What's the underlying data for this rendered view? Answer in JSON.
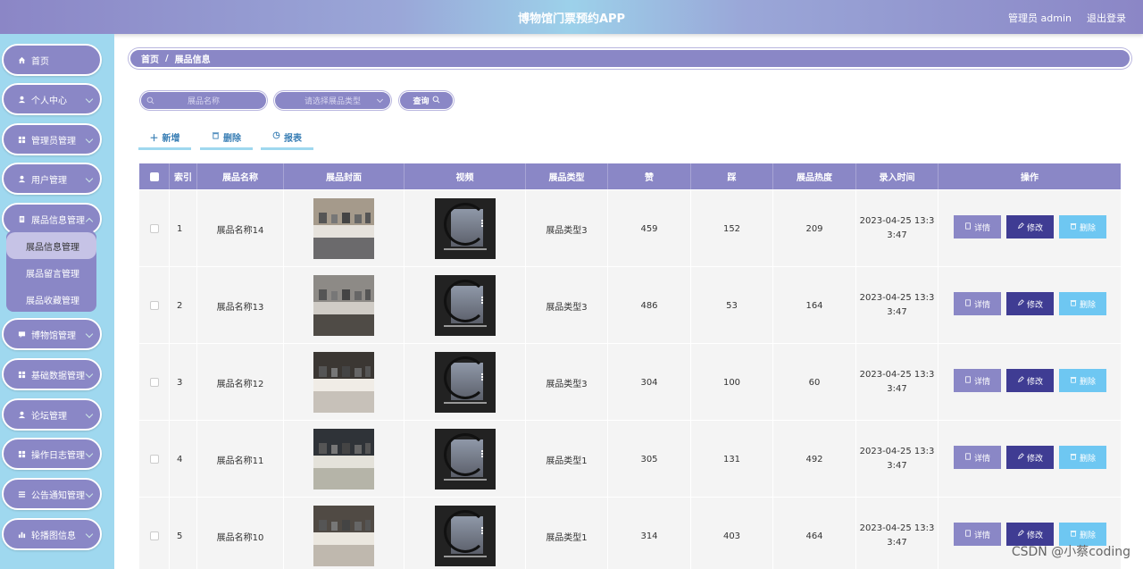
{
  "header": {
    "title": "博物馆门票预约APP",
    "admin": "管理员 admin",
    "logout": "退出登录"
  },
  "sidebar": {
    "items": [
      {
        "label": "首页",
        "icon": "home-icon"
      },
      {
        "label": "个人中心",
        "icon": "user-icon"
      },
      {
        "label": "管理员管理",
        "icon": "grid-icon"
      },
      {
        "label": "用户管理",
        "icon": "user-icon"
      },
      {
        "label": "展品信息管理",
        "icon": "doc-icon"
      },
      {
        "label": "博物馆管理",
        "icon": "chat-icon"
      },
      {
        "label": "基础数据管理",
        "icon": "grid-icon"
      },
      {
        "label": "论坛管理",
        "icon": "user-icon"
      },
      {
        "label": "操作日志管理",
        "icon": "grid-icon"
      },
      {
        "label": "公告通知管理",
        "icon": "list-icon"
      },
      {
        "label": "轮播图信息",
        "icon": "chart-icon"
      }
    ],
    "submenu": [
      "展品信息管理",
      "展品留言管理",
      "展品收藏管理"
    ]
  },
  "breadcrumb": {
    "home": "首页",
    "sep": "/",
    "current": "展品信息"
  },
  "search": {
    "name_placeholder": "展品名称",
    "type_placeholder": "请选择展品类型",
    "query": "查询"
  },
  "actions": {
    "add": "新增",
    "delete": "删除",
    "report": "报表"
  },
  "table": {
    "headers": [
      "",
      "索引",
      "展品名称",
      "展品封面",
      "视频",
      "展品类型",
      "赞",
      "踩",
      "展品热度",
      "录入时间",
      "操作"
    ],
    "rows": [
      {
        "index": "1",
        "name": "展品名称14",
        "type": "展品类型3",
        "like": "459",
        "dislike": "152",
        "heat": "209",
        "time1": "2023-04-25 13:3",
        "time2": "3:47"
      },
      {
        "index": "2",
        "name": "展品名称13",
        "type": "展品类型3",
        "like": "486",
        "dislike": "53",
        "heat": "164",
        "time1": "2023-04-25 13:3",
        "time2": "3:47"
      },
      {
        "index": "3",
        "name": "展品名称12",
        "type": "展品类型3",
        "like": "304",
        "dislike": "100",
        "heat": "60",
        "time1": "2023-04-25 13:3",
        "time2": "3:47"
      },
      {
        "index": "4",
        "name": "展品名称11",
        "type": "展品类型1",
        "like": "305",
        "dislike": "131",
        "heat": "492",
        "time1": "2023-04-25 13:3",
        "time2": "3:47"
      },
      {
        "index": "5",
        "name": "展品名称10",
        "type": "展品类型1",
        "like": "314",
        "dislike": "403",
        "heat": "464",
        "time1": "2023-04-25 13:3",
        "time2": "3:47"
      }
    ],
    "ops": {
      "detail": "详情",
      "edit": "修改",
      "delete": "删除"
    }
  },
  "watermark": "CSDN @小蔡coding",
  "colors": {
    "primary": "#8a87c6",
    "sidebar_bg": "#9fd8ef",
    "edit": "#3f3c93",
    "delete": "#6ec7f2"
  }
}
